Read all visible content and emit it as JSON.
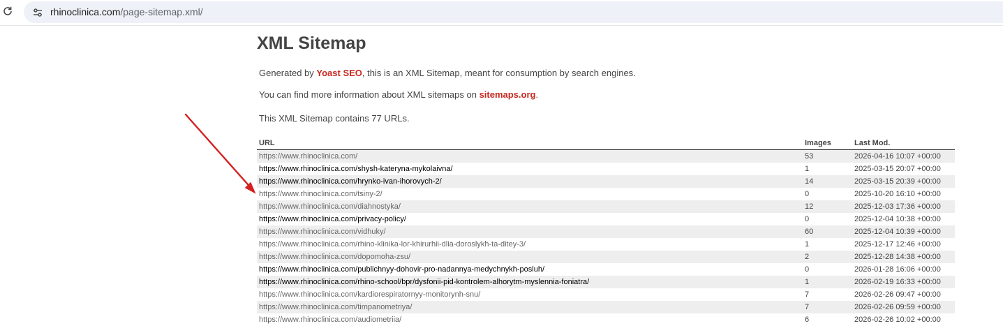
{
  "browser": {
    "url_domain": "rhinoclinica.com",
    "url_path": "/page-sitemap.xml/"
  },
  "page": {
    "title": "XML Sitemap",
    "intro1_before": "Generated by ",
    "intro1_link": "Yoast SEO",
    "intro1_after": ", this is an XML Sitemap, meant for consumption by search engines.",
    "intro2_before": "You can find more information about XML sitemaps on ",
    "intro2_link": "sitemaps.org",
    "intro2_after": ".",
    "count_text": "This XML Sitemap contains 77 URLs.",
    "link_color": "#c9281f"
  },
  "table": {
    "headers": {
      "url": "URL",
      "images": "Images",
      "lastmod": "Last Mod."
    },
    "rows": [
      {
        "url": "https://www.rhinoclinica.com/",
        "images": "53",
        "lastmod": "2026-04-16 10:07 +00:00",
        "visited": true
      },
      {
        "url": "https://www.rhinoclinica.com/shysh-kateryna-mykolaivna/",
        "images": "1",
        "lastmod": "2025-03-15 20:07 +00:00",
        "visited": false
      },
      {
        "url": "https://www.rhinoclinica.com/hrynko-ivan-ihorovych-2/",
        "images": "14",
        "lastmod": "2025-03-15 20:39 +00:00",
        "visited": false
      },
      {
        "url": "https://www.rhinoclinica.com/tsiny-2/",
        "images": "0",
        "lastmod": "2025-10-20 16:10 +00:00",
        "visited": true
      },
      {
        "url": "https://www.rhinoclinica.com/diahnostyka/",
        "images": "12",
        "lastmod": "2025-12-03 17:36 +00:00",
        "visited": true
      },
      {
        "url": "https://www.rhinoclinica.com/privacy-policy/",
        "images": "0",
        "lastmod": "2025-12-04 10:38 +00:00",
        "visited": false
      },
      {
        "url": "https://www.rhinoclinica.com/vidhuky/",
        "images": "60",
        "lastmod": "2025-12-04 10:39 +00:00",
        "visited": true
      },
      {
        "url": "https://www.rhinoclinica.com/rhino-klinika-lor-khirurhii-dlia-doroslykh-ta-ditey-3/",
        "images": "1",
        "lastmod": "2025-12-17 12:46 +00:00",
        "visited": true
      },
      {
        "url": "https://www.rhinoclinica.com/dopomoha-zsu/",
        "images": "2",
        "lastmod": "2025-12-28 14:38 +00:00",
        "visited": true
      },
      {
        "url": "https://www.rhinoclinica.com/publichnyy-dohovir-pro-nadannya-medychnykh-posluh/",
        "images": "0",
        "lastmod": "2026-01-28 16:06 +00:00",
        "visited": false
      },
      {
        "url": "https://www.rhinoclinica.com/rhino-school/bpr/dysfonii-pid-kontrolem-alhorytm-myslennia-foniatra/",
        "images": "1",
        "lastmod": "2026-02-19 16:33 +00:00",
        "visited": false
      },
      {
        "url": "https://www.rhinoclinica.com/kardiorespiratornyy-monitorynh-snu/",
        "images": "7",
        "lastmod": "2026-02-26 09:47 +00:00",
        "visited": true
      },
      {
        "url": "https://www.rhinoclinica.com/timpanometriya/",
        "images": "7",
        "lastmod": "2026-02-26 09:59 +00:00",
        "visited": true
      },
      {
        "url": "https://www.rhinoclinica.com/audiometriia/",
        "images": "6",
        "lastmod": "2026-02-26 10:02 +00:00",
        "visited": true
      }
    ]
  },
  "annotation": {
    "arrow_color": "#d42020"
  },
  "icons": {
    "reload": "reload-icon",
    "site_info": "site-info-icon"
  }
}
